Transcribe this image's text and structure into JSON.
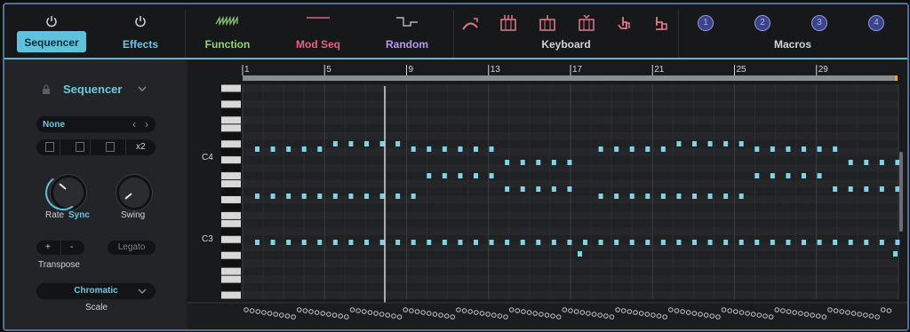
{
  "tabs": {
    "sequencer": "Sequencer",
    "effects": "Effects",
    "function": "Function",
    "modseq": "Mod Seq",
    "random": "Random",
    "keyboard": "Keyboard",
    "macros": "Macros"
  },
  "colors": {
    "accent": "#5fc2dc",
    "function_green": "#8fd47a",
    "modseq_pink": "#e8607d",
    "random_purple": "#b89ae6",
    "keyboard_icon": "#e4788c",
    "macro_blue": "#8c98ee"
  },
  "macros": [
    "1",
    "2",
    "3",
    "4"
  ],
  "left": {
    "title": "Sequencer",
    "preset": "None",
    "x2": "x2",
    "rate_label": "Rate",
    "sync_label": "Sync",
    "swing_label": "Swing",
    "plus": "+",
    "minus": "-",
    "legato": "Legato",
    "transpose_label": "Transpose",
    "scale_value": "Chromatic",
    "scale_label": "Scale"
  },
  "grid": {
    "bar_numbers": [
      "1",
      "5",
      "9",
      "13",
      "17",
      "21",
      "25",
      "29"
    ],
    "note_labels": [
      "C4",
      "C3"
    ]
  }
}
